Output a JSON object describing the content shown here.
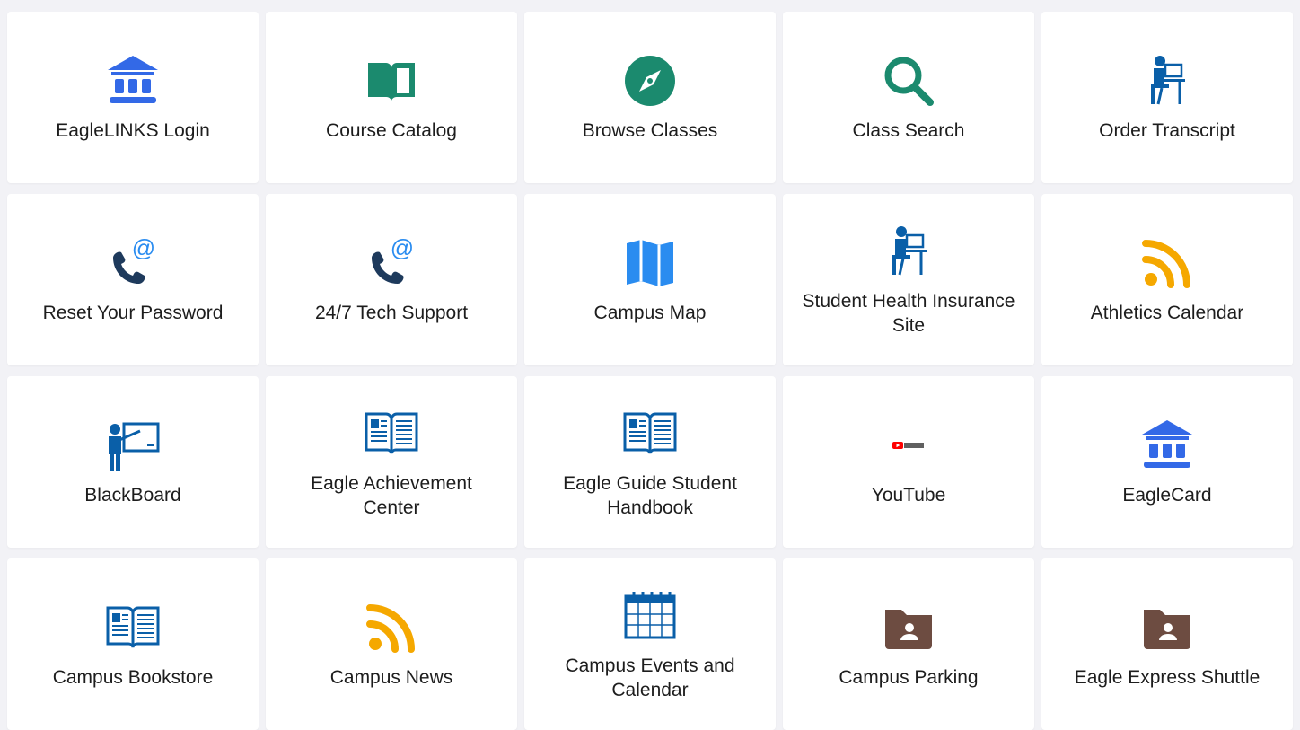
{
  "tiles": [
    {
      "label": "EagleLINKS Login",
      "icon": "bank-icon",
      "color": "#3369e7"
    },
    {
      "label": "Course Catalog",
      "icon": "book-open-icon",
      "color": "#1b8a6e"
    },
    {
      "label": "Browse Classes",
      "icon": "compass-icon",
      "color": "#1b8a6e"
    },
    {
      "label": "Class Search",
      "icon": "search-icon",
      "color": "#1b8a6e"
    },
    {
      "label": "Order Transcript",
      "icon": "person-at-desk-icon",
      "color": "#0a5fa8"
    },
    {
      "label": "Reset Your Password",
      "icon": "phone-at-icon",
      "color": "#1e3a5c"
    },
    {
      "label": "24/7 Tech Support",
      "icon": "phone-at-icon",
      "color": "#1e3a5c"
    },
    {
      "label": "Campus Map",
      "icon": "map-icon",
      "color": "#2a8cf0"
    },
    {
      "label": "Student Health Insurance Site",
      "icon": "person-at-desk-icon",
      "color": "#0a5fa8"
    },
    {
      "label": "Athletics Calendar",
      "icon": "rss-icon",
      "color": "#f5a800"
    },
    {
      "label": "BlackBoard",
      "icon": "teacher-board-icon",
      "color": "#0a5fa8"
    },
    {
      "label": "Eagle Achievement Center",
      "icon": "open-book-icon",
      "color": "#0a5fa8"
    },
    {
      "label": "Eagle Guide Student Handbook",
      "icon": "open-book-icon",
      "color": "#0a5fa8"
    },
    {
      "label": "YouTube",
      "icon": "youtube-logo-icon",
      "color": "#ff0000"
    },
    {
      "label": "EagleCard",
      "icon": "bank-icon",
      "color": "#3369e7"
    },
    {
      "label": "Campus Bookstore",
      "icon": "open-book-icon",
      "color": "#0a5fa8"
    },
    {
      "label": "Campus News",
      "icon": "rss-icon",
      "color": "#f5a800"
    },
    {
      "label": "Campus Events and Calendar",
      "icon": "calendar-icon",
      "color": "#0a5fa8"
    },
    {
      "label": "Campus Parking",
      "icon": "folder-person-icon",
      "color": "#6d4c41"
    },
    {
      "label": "Eagle Express Shuttle",
      "icon": "folder-person-icon",
      "color": "#6d4c41"
    }
  ]
}
